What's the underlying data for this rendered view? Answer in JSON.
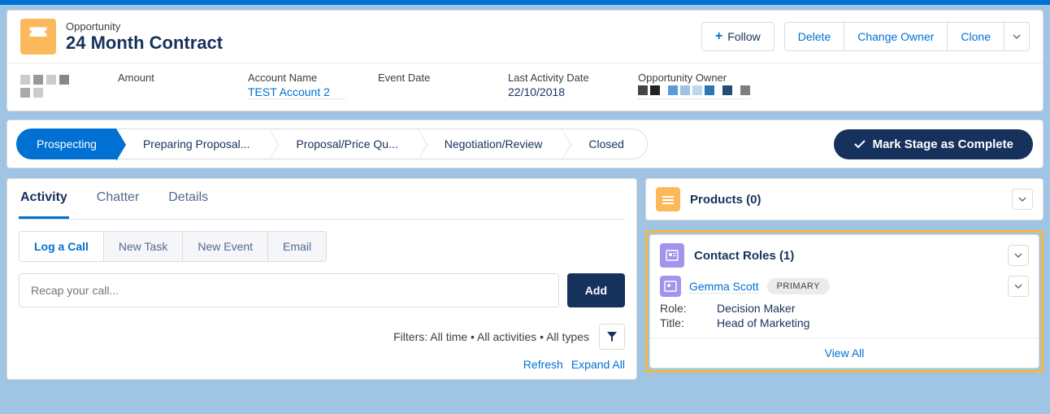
{
  "header": {
    "object_label": "Opportunity",
    "title": "24 Month Contract",
    "actions": {
      "follow": "Follow",
      "delete": "Delete",
      "change_owner": "Change Owner",
      "clone": "Clone"
    }
  },
  "fields": {
    "amount_label": "Amount",
    "account_label": "Account Name",
    "account_value": "TEST Account 2",
    "event_date_label": "Event Date",
    "last_activity_label": "Last Activity Date",
    "last_activity_value": "22/10/2018",
    "owner_label": "Opportunity Owner"
  },
  "path": {
    "stages": [
      "Prospecting",
      "Preparing Proposal...",
      "Proposal/Price Qu...",
      "Negotiation/Review",
      "Closed"
    ],
    "active_index": 0,
    "mark_complete": "Mark Stage as Complete"
  },
  "tabs": {
    "items": [
      "Activity",
      "Chatter",
      "Details"
    ],
    "active_index": 0
  },
  "subtabs": {
    "items": [
      "Log a Call",
      "New Task",
      "New Event",
      "Email"
    ],
    "active_index": 0
  },
  "call": {
    "placeholder": "Recap your call...",
    "add_label": "Add"
  },
  "filters": {
    "text": "Filters: All time • All activities • All types",
    "refresh": "Refresh",
    "expand": "Expand All"
  },
  "related": {
    "products": {
      "title": "Products (0)"
    },
    "contact_roles": {
      "title": "Contact Roles (1)",
      "contact_name": "Gemma Scott",
      "badge": "PRIMARY",
      "role_label": "Role:",
      "role_value": "Decision Maker",
      "title_label": "Title:",
      "title_value": "Head of Marketing",
      "view_all": "View All"
    }
  }
}
